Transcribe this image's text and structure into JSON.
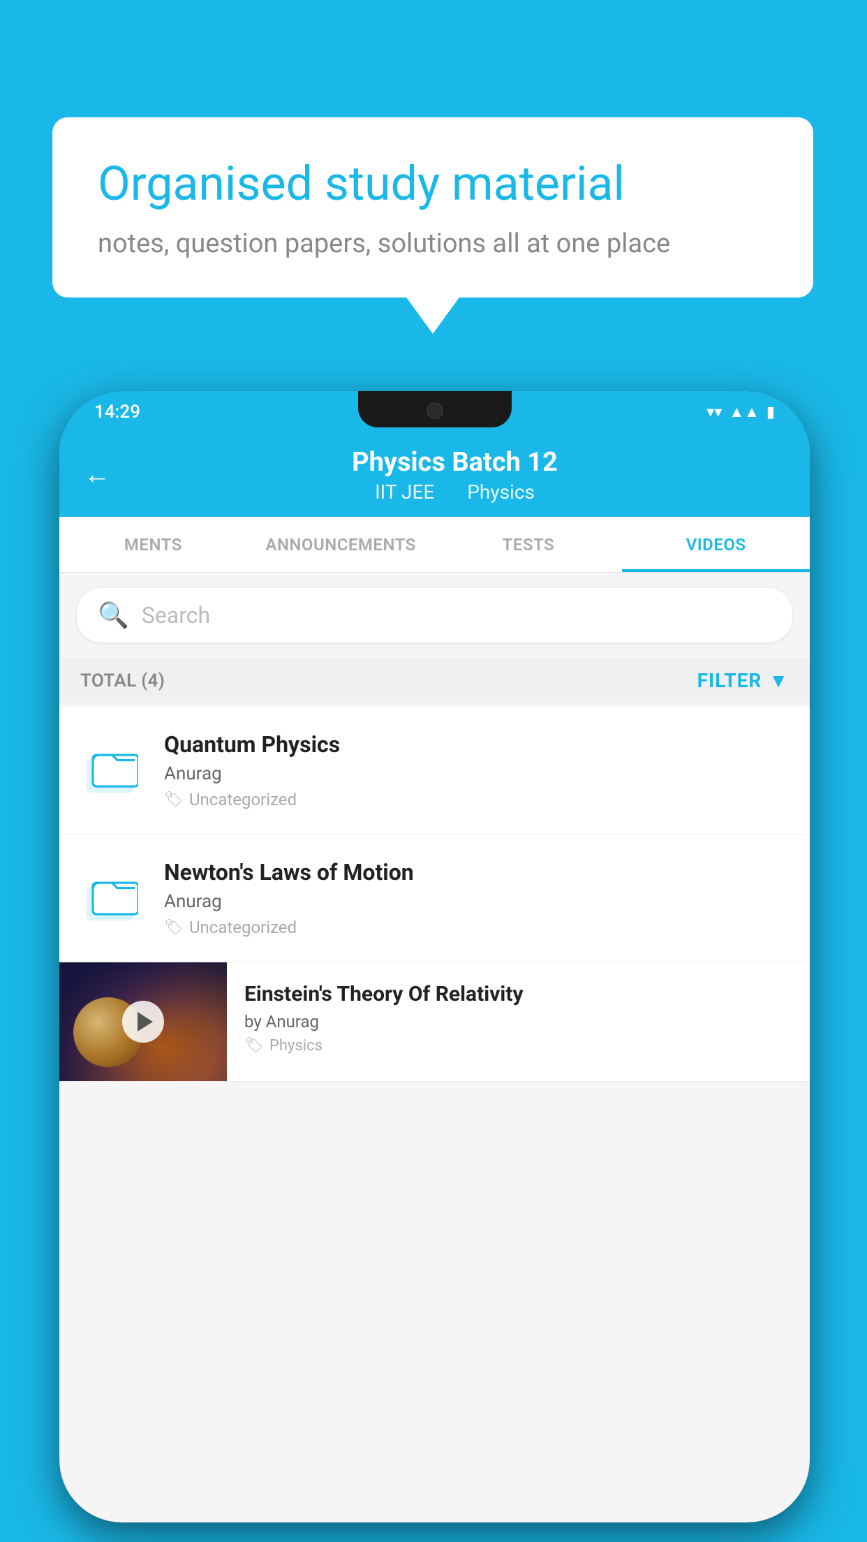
{
  "background_color": "#1ab8e8",
  "speech_bubble": {
    "title": "Organised study material",
    "subtitle": "notes, question papers, solutions all at one place"
  },
  "status_bar": {
    "time": "14:29",
    "icons": [
      "wifi",
      "signal",
      "battery"
    ]
  },
  "app_header": {
    "title": "Physics Batch 12",
    "subtitle_left": "IIT JEE",
    "subtitle_right": "Physics",
    "back_label": "←"
  },
  "tabs": [
    {
      "label": "MENTS",
      "active": false
    },
    {
      "label": "ANNOUNCEMENTS",
      "active": false
    },
    {
      "label": "TESTS",
      "active": false
    },
    {
      "label": "VIDEOS",
      "active": true
    }
  ],
  "search": {
    "placeholder": "Search"
  },
  "filter_bar": {
    "total_label": "TOTAL (4)",
    "filter_label": "FILTER"
  },
  "videos": [
    {
      "title": "Quantum Physics",
      "author": "Anurag",
      "tag": "Uncategorized",
      "type": "folder",
      "thumb": null
    },
    {
      "title": "Newton's Laws of Motion",
      "author": "Anurag",
      "tag": "Uncategorized",
      "type": "folder",
      "thumb": null
    },
    {
      "title": "Einstein's Theory Of Relativity",
      "author": "by Anurag",
      "tag": "Physics",
      "type": "video",
      "thumb": "space"
    }
  ],
  "accent_color": "#1ab8e8"
}
